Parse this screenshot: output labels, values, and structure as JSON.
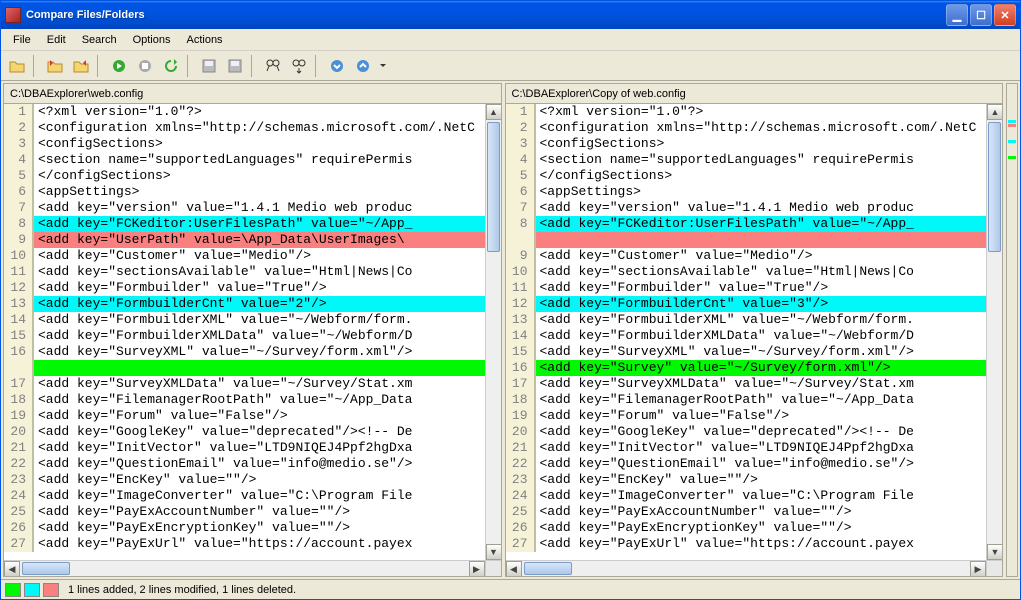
{
  "window": {
    "title": "Compare Files/Folders"
  },
  "menu": {
    "file": "File",
    "edit": "Edit",
    "search": "Search",
    "options": "Options",
    "actions": "Actions"
  },
  "toolbar_icons": {
    "open": "open-folder",
    "open_left": "open-left",
    "open_right": "open-right",
    "next": "next-diff",
    "stop": "stop",
    "refresh": "refresh",
    "save_left": "save-left",
    "save_right": "save-right",
    "find": "find",
    "find_next": "find-next",
    "up": "prev-diff",
    "down": "next-diff2"
  },
  "left": {
    "path": "C:\\DBAExplorer\\web.config",
    "lines": [
      {
        "n": 1,
        "t": "<?xml version=\"1.0\"?>"
      },
      {
        "n": 2,
        "t": "<configuration xmlns=\"http://schemas.microsoft.com/.NetC"
      },
      {
        "n": 3,
        "t": "    <configSections>"
      },
      {
        "n": 4,
        "t": "        <section name=\"supportedLanguages\" requirePermis"
      },
      {
        "n": 5,
        "t": "    </configSections>"
      },
      {
        "n": 6,
        "t": "    <appSettings>"
      },
      {
        "n": 7,
        "t": "        <add key=\"version\" value=\"1.4.1 Medio web produc"
      },
      {
        "n": 8,
        "t": "        <add key=\"FCKeditor:UserFilesPath\" value=\"~/App_",
        "hl": "changed"
      },
      {
        "n": 9,
        "t": "        <add key=\"UserPath\" value=\\App_Data\\UserImages\\",
        "hl": "deleted"
      },
      {
        "n": 10,
        "t": "        <add key=\"Customer\" value=\"Medio\"/>"
      },
      {
        "n": 11,
        "t": "        <add key=\"sectionsAvailable\" value=\"Html|News|Co"
      },
      {
        "n": 12,
        "t": "        <add key=\"Formbuilder\" value=\"True\"/>"
      },
      {
        "n": 13,
        "t": "        <add key=\"FormbuilderCnt\" value=\"2\"/>",
        "hl": "changed"
      },
      {
        "n": 14,
        "t": "        <add key=\"FormbuilderXML\" value=\"~/Webform/form."
      },
      {
        "n": 15,
        "t": "        <add key=\"FormbuilderXMLData\" value=\"~/Webform/D"
      },
      {
        "n": 16,
        "t": "        <add key=\"SurveyXML\" value=\"~/Survey/form.xml\"/>"
      },
      {
        "n": "",
        "t": "",
        "hl": "added"
      },
      {
        "n": 17,
        "t": "        <add key=\"SurveyXMLData\" value=\"~/Survey/Stat.xm"
      },
      {
        "n": 18,
        "t": "        <add key=\"FilemanagerRootPath\" value=\"~/App_Data"
      },
      {
        "n": 19,
        "t": "        <add key=\"Forum\" value=\"False\"/>"
      },
      {
        "n": 20,
        "t": "        <add key=\"GoogleKey\" value=\"deprecated\"/><!-- De"
      },
      {
        "n": 21,
        "t": "        <add key=\"InitVector\" value=\"LTD9NIQEJ4Ppf2hgDxa"
      },
      {
        "n": 22,
        "t": "        <add key=\"QuestionEmail\" value=\"info@medio.se\"/>"
      },
      {
        "n": 23,
        "t": "        <add key=\"EncKey\" value=\"\"/>"
      },
      {
        "n": 24,
        "t": "        <add key=\"ImageConverter\" value=\"C:\\Program File"
      },
      {
        "n": 25,
        "t": "        <add key=\"PayExAccountNumber\" value=\"\"/>"
      },
      {
        "n": 26,
        "t": "        <add key=\"PayExEncryptionKey\" value=\"\"/>"
      },
      {
        "n": 27,
        "t": "        <add key=\"PayExUrl\" value=\"https://account.payex"
      }
    ]
  },
  "right": {
    "path": "C:\\DBAExplorer\\Copy of web.config",
    "lines": [
      {
        "n": 1,
        "t": "<?xml version=\"1.0\"?>"
      },
      {
        "n": 2,
        "t": "<configuration xmlns=\"http://schemas.microsoft.com/.NetC"
      },
      {
        "n": 3,
        "t": "    <configSections>"
      },
      {
        "n": 4,
        "t": "        <section name=\"supportedLanguages\" requirePermis"
      },
      {
        "n": 5,
        "t": "    </configSections>"
      },
      {
        "n": 6,
        "t": "    <appSettings>"
      },
      {
        "n": 7,
        "t": "        <add key=\"version\" value=\"1.4.1 Medio web produc"
      },
      {
        "n": 8,
        "t": "        <add key=\"FCKeditor:UserFilesPath\" value=\"~/App_",
        "hl": "changed"
      },
      {
        "n": "",
        "t": "",
        "hl": "deleted"
      },
      {
        "n": 9,
        "t": "        <add key=\"Customer\" value=\"Medio\"/>"
      },
      {
        "n": 10,
        "t": "        <add key=\"sectionsAvailable\" value=\"Html|News|Co"
      },
      {
        "n": 11,
        "t": "        <add key=\"Formbuilder\" value=\"True\"/>"
      },
      {
        "n": 12,
        "t": "        <add key=\"FormbuilderCnt\" value=\"3\"/>",
        "hl": "changed"
      },
      {
        "n": 13,
        "t": "        <add key=\"FormbuilderXML\" value=\"~/Webform/form."
      },
      {
        "n": 14,
        "t": "        <add key=\"FormbuilderXMLData\" value=\"~/Webform/D"
      },
      {
        "n": 15,
        "t": "        <add key=\"SurveyXML\" value=\"~/Survey/form.xml\"/>"
      },
      {
        "n": 16,
        "t": "        <add key=\"Survey\" value=\"~/Survey/form.xml\"/>",
        "hl": "added"
      },
      {
        "n": 17,
        "t": "        <add key=\"SurveyXMLData\" value=\"~/Survey/Stat.xm"
      },
      {
        "n": 18,
        "t": "        <add key=\"FilemanagerRootPath\" value=\"~/App_Data"
      },
      {
        "n": 19,
        "t": "        <add key=\"Forum\" value=\"False\"/>"
      },
      {
        "n": 20,
        "t": "        <add key=\"GoogleKey\" value=\"deprecated\"/><!-- De"
      },
      {
        "n": 21,
        "t": "        <add key=\"InitVector\" value=\"LTD9NIQEJ4Ppf2hgDxa"
      },
      {
        "n": 22,
        "t": "        <add key=\"QuestionEmail\" value=\"info@medio.se\"/>"
      },
      {
        "n": 23,
        "t": "        <add key=\"EncKey\" value=\"\"/>"
      },
      {
        "n": 24,
        "t": "        <add key=\"ImageConverter\" value=\"C:\\Program File"
      },
      {
        "n": 25,
        "t": "        <add key=\"PayExAccountNumber\" value=\"\"/>"
      },
      {
        "n": 26,
        "t": "        <add key=\"PayExEncryptionKey\" value=\"\"/>"
      },
      {
        "n": 27,
        "t": "        <add key=\"PayExUrl\" value=\"https://account.payex"
      }
    ]
  },
  "status": {
    "summary": "1 lines added, 2 lines modified, 1 lines deleted."
  },
  "colors": {
    "changed": "#00f8f8",
    "deleted": "#fa8080",
    "added": "#00f800"
  }
}
